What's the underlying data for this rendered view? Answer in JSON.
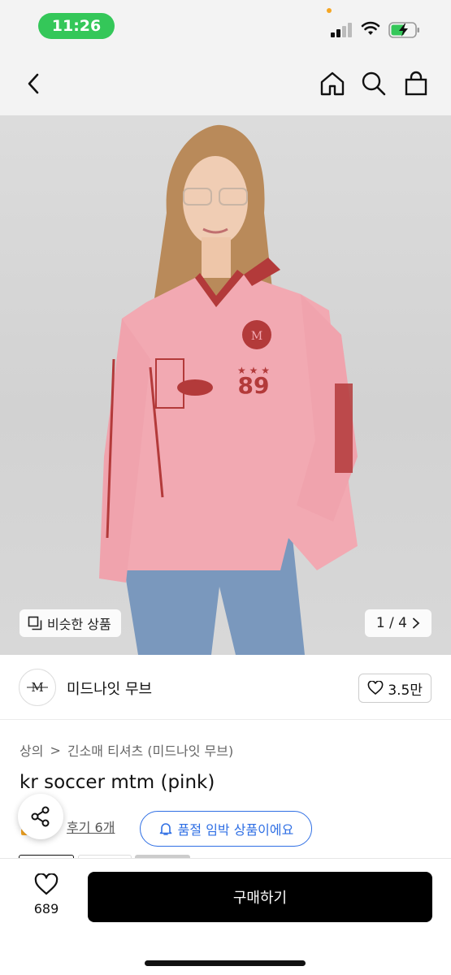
{
  "status": {
    "time": "11:26",
    "icons": [
      "signal-icon",
      "wifi-icon",
      "battery-charging-icon"
    ],
    "accent_time_bg": "#34c759"
  },
  "nav": {
    "icons": [
      "back-chevron-icon",
      "home-icon",
      "search-icon",
      "shopping-bag-icon"
    ]
  },
  "gallery": {
    "similar_label": "비슷한 상품",
    "page_counter": "1 / 4"
  },
  "shop": {
    "name": "미드나잇 무브",
    "likes": "3.5만"
  },
  "breadcrumb": {
    "category": "상의",
    "separator": ">",
    "subcategory": "긴소매 티셔츠 (미드나잇 무브)"
  },
  "product": {
    "title": "kr soccer mtm (pink)",
    "review_link": "후기 6개",
    "stock_badge": "품절 임박 상품이에요"
  },
  "bottom": {
    "wish_count": "689",
    "buy_label": "구매하기"
  },
  "colors": {
    "accent_blue": "#2f6fe4",
    "buy_button": "#000000"
  }
}
